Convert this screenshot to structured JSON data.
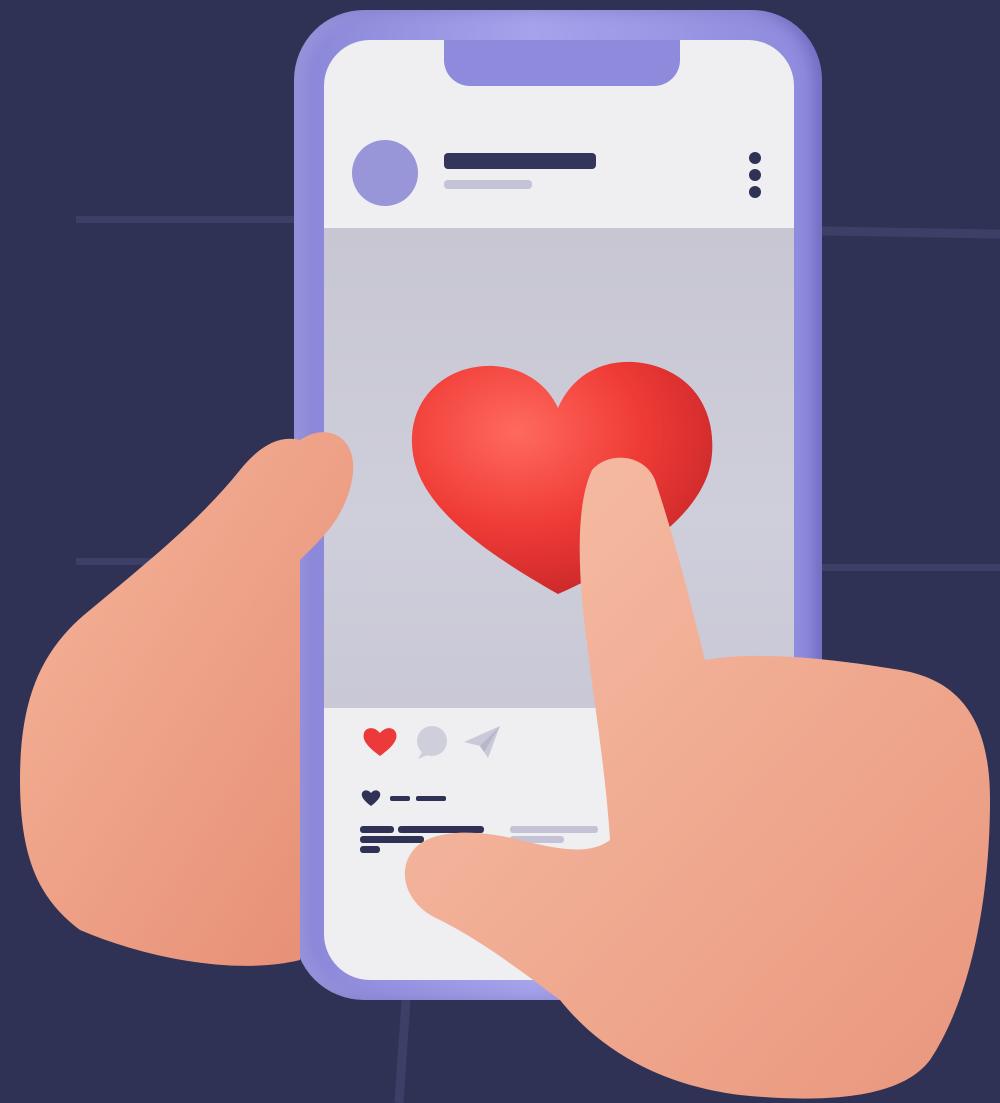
{
  "colors": {
    "background": "#2f3254",
    "phone_frame": "#9c99e6",
    "screen": "#efeff2",
    "heart": "#ef3b36",
    "dark_ui": "#2f3254",
    "muted_ui": "#c3c2d6",
    "skin": "#f2a98e"
  },
  "icons": {
    "menu": "vertical-dots-icon",
    "like": "heart-icon",
    "comment": "speech-bubble-icon",
    "share": "paper-plane-icon",
    "likes": "small-heart-icon",
    "hero": "large-heart-icon"
  }
}
